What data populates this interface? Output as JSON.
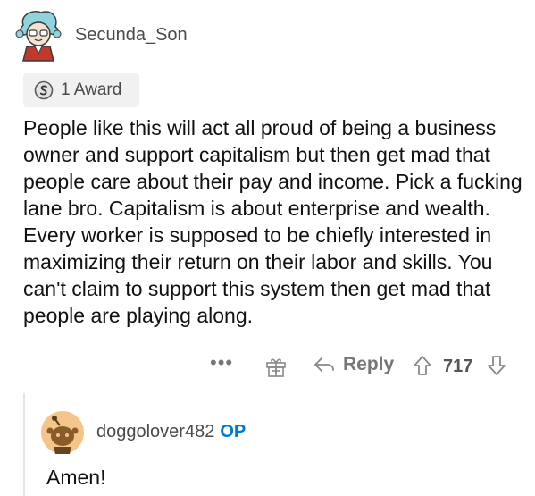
{
  "comment": {
    "username": "Secunda_Son",
    "award": {
      "count_label": "1 Award",
      "icon": "silver-award-icon"
    },
    "body": "People like this will act all proud of being a business owner and support capitalism but then get mad that people care about their pay and income. Pick a fucking lane bro. Capitalism is about enterprise and wealth. Every worker is supposed to be chiefly interested in maximizing their return on their labor and skills. You can't claim to support this system then get mad that people are playing along.",
    "actions": {
      "more": "•••",
      "reply_label": "Reply",
      "score": "717"
    }
  },
  "reply": {
    "username": "doggolover482",
    "op_tag": "OP",
    "body": "Amen!"
  },
  "colors": {
    "accent": "#0079d3",
    "muted": "#7c7c7c",
    "award_bg": "#f1f1f2"
  }
}
